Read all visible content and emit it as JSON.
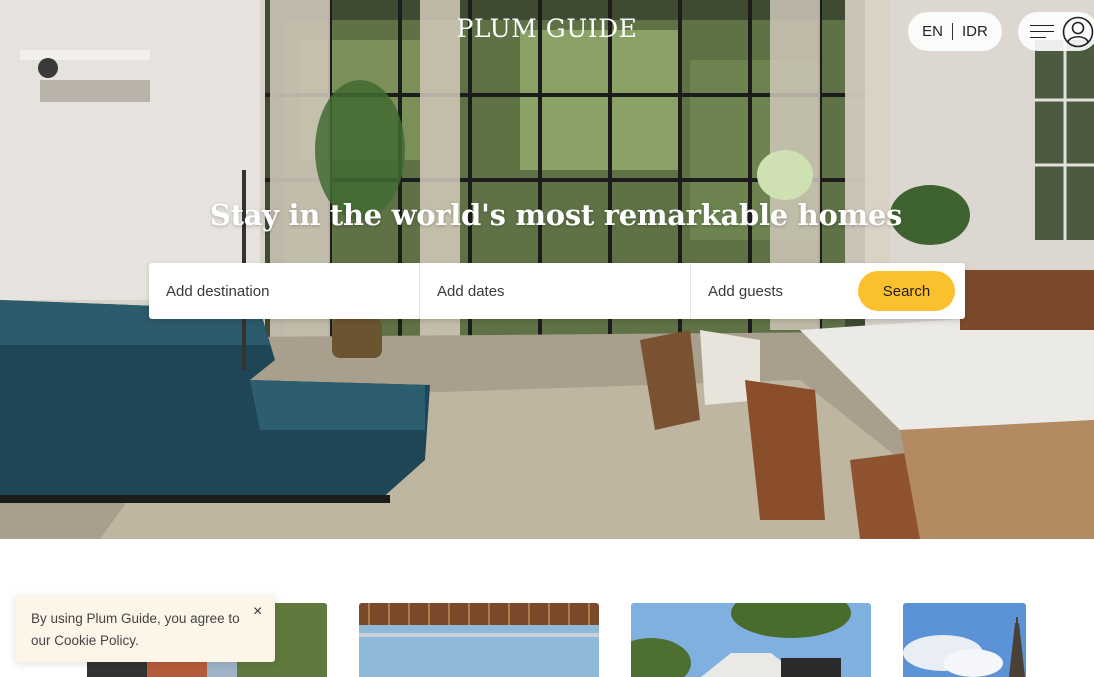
{
  "header": {
    "logo": "PLUM GUIDE",
    "language": "EN",
    "currency": "IDR",
    "menu_icon": "hamburger-icon",
    "account_icon": "user-icon"
  },
  "hero": {
    "headline": "Stay in the world's most remarkable homes"
  },
  "search": {
    "destination_placeholder": "Add destination",
    "dates_placeholder": "Add dates",
    "guests_placeholder": "Add guests",
    "button_label": "Search",
    "button_color": "#fbc02d"
  },
  "cookie_banner": {
    "text": "By using Plum Guide, you agree to our Cookie Policy.",
    "close_symbol": "×",
    "close_icon": "close-icon"
  },
  "colors": {
    "background": "#ffffff",
    "accent": "#fbc02d",
    "cookie_bg": "#fdf5e8"
  }
}
